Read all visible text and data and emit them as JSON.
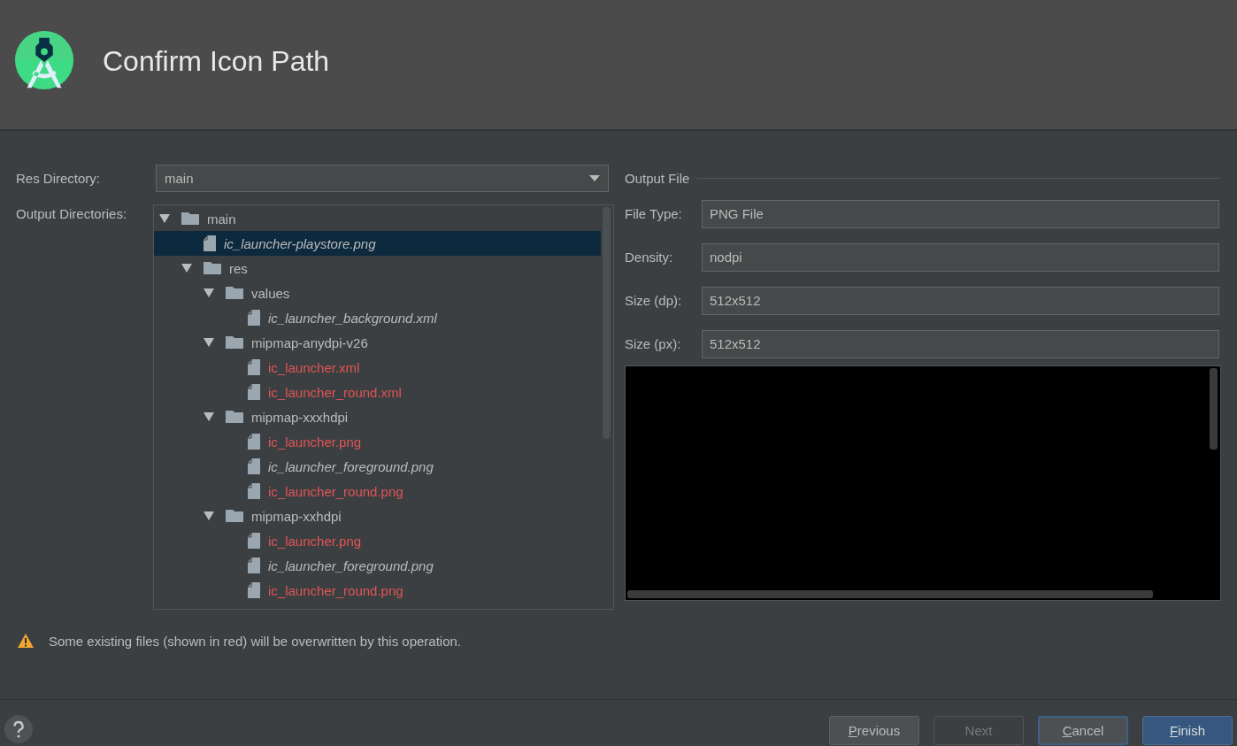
{
  "window": {
    "title": "Confirm Icon Path"
  },
  "res_directory": {
    "label": "Res Directory:",
    "value": "main"
  },
  "output_directories": {
    "label": "Output Directories:",
    "tree": [
      {
        "kind": "folder",
        "name": "main",
        "expanded": true,
        "selected": false,
        "children": [
          {
            "kind": "file",
            "name": "ic_launcher-playstore.png",
            "selected": true,
            "overwritten": false
          },
          {
            "kind": "folder",
            "name": "res",
            "expanded": true,
            "selected": false,
            "children": [
              {
                "kind": "folder",
                "name": "values",
                "expanded": true,
                "selected": false,
                "children": [
                  {
                    "kind": "file",
                    "name": "ic_launcher_background.xml",
                    "selected": false,
                    "overwritten": false
                  }
                ]
              },
              {
                "kind": "folder",
                "name": "mipmap-anydpi-v26",
                "expanded": true,
                "selected": false,
                "children": [
                  {
                    "kind": "file",
                    "name": "ic_launcher.xml",
                    "selected": false,
                    "overwritten": true
                  },
                  {
                    "kind": "file",
                    "name": "ic_launcher_round.xml",
                    "selected": false,
                    "overwritten": true
                  }
                ]
              },
              {
                "kind": "folder",
                "name": "mipmap-xxxhdpi",
                "expanded": true,
                "selected": false,
                "children": [
                  {
                    "kind": "file",
                    "name": "ic_launcher.png",
                    "selected": false,
                    "overwritten": true
                  },
                  {
                    "kind": "file",
                    "name": "ic_launcher_foreground.png",
                    "selected": false,
                    "overwritten": false
                  },
                  {
                    "kind": "file",
                    "name": "ic_launcher_round.png",
                    "selected": false,
                    "overwritten": true
                  }
                ]
              },
              {
                "kind": "folder",
                "name": "mipmap-xxhdpi",
                "expanded": true,
                "selected": false,
                "children": [
                  {
                    "kind": "file",
                    "name": "ic_launcher.png",
                    "selected": false,
                    "overwritten": true
                  },
                  {
                    "kind": "file",
                    "name": "ic_launcher_foreground.png",
                    "selected": false,
                    "overwritten": false
                  },
                  {
                    "kind": "file",
                    "name": "ic_launcher_round.png",
                    "selected": false,
                    "overwritten": true
                  }
                ]
              }
            ]
          }
        ]
      }
    ]
  },
  "output_file": {
    "title": "Output File",
    "fields": [
      {
        "label": "File Type:",
        "value": "PNG File"
      },
      {
        "label": "Density:",
        "value": "nodpi"
      },
      {
        "label": "Size (dp):",
        "value": "512x512"
      },
      {
        "label": "Size (px):",
        "value": "512x512"
      }
    ]
  },
  "warning": "Some existing files (shown in red) will be overwritten by this operation.",
  "buttons": [
    {
      "label": "Previous",
      "underline_first": true,
      "disabled": false,
      "focused": false,
      "default": false
    },
    {
      "label": "Next",
      "underline_first": false,
      "disabled": true,
      "focused": false,
      "default": false
    },
    {
      "label": "Cancel",
      "underline_first": true,
      "disabled": false,
      "focused": true,
      "default": false
    },
    {
      "label": "Finish",
      "underline_first": true,
      "disabled": false,
      "focused": false,
      "default": true
    }
  ]
}
